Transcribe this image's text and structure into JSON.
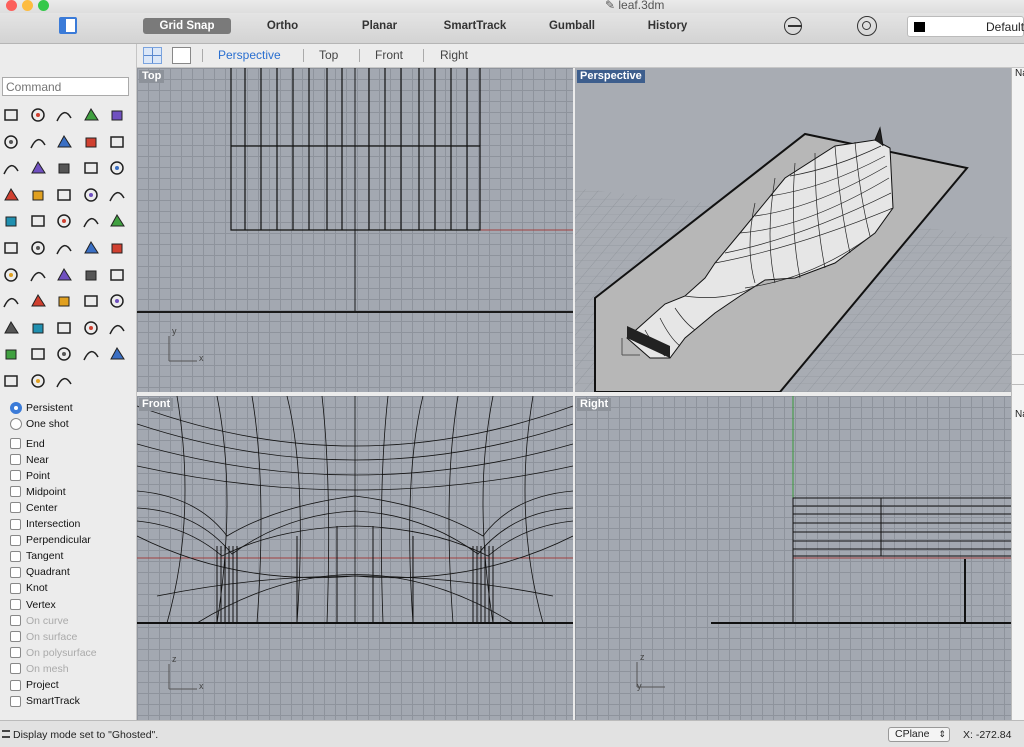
{
  "window": {
    "title": "leaf.3dm"
  },
  "toolbar": {
    "buttons": [
      "Grid Snap",
      "Ortho",
      "Planar",
      "SmartTrack",
      "Gumball",
      "History"
    ],
    "layer_name": "Default"
  },
  "viewport_tabs": [
    "Perspective",
    "Top",
    "Front",
    "Right"
  ],
  "command": {
    "placeholder": "Command"
  },
  "viewports": {
    "top": "Top",
    "perspective": "Perspective",
    "front": "Front",
    "right": "Right"
  },
  "axes": {
    "x": "x",
    "y": "y",
    "z": "z"
  },
  "osnap": {
    "modes": [
      "Persistent",
      "One shot"
    ],
    "items": [
      {
        "label": "End",
        "enabled": true
      },
      {
        "label": "Near",
        "enabled": true
      },
      {
        "label": "Point",
        "enabled": true
      },
      {
        "label": "Midpoint",
        "enabled": true
      },
      {
        "label": "Center",
        "enabled": true
      },
      {
        "label": "Intersection",
        "enabled": true
      },
      {
        "label": "Perpendicular",
        "enabled": true
      },
      {
        "label": "Tangent",
        "enabled": true
      },
      {
        "label": "Quadrant",
        "enabled": true
      },
      {
        "label": "Knot",
        "enabled": true
      },
      {
        "label": "Vertex",
        "enabled": true
      },
      {
        "label": "On curve",
        "enabled": false
      },
      {
        "label": "On surface",
        "enabled": false
      },
      {
        "label": "On polysurface",
        "enabled": false
      },
      {
        "label": "On mesh",
        "enabled": false
      },
      {
        "label": "Project",
        "enabled": true
      },
      {
        "label": "SmartTrack",
        "enabled": true
      }
    ]
  },
  "right_panel": {
    "label1": "Na",
    "label2": "Na"
  },
  "status": {
    "message": "Display mode set to \"Ghosted\".",
    "cplane": "CPlane",
    "coord_x": "X: -272.84"
  },
  "icons": [
    "menu-icon",
    "sidebar-toggle-icon",
    "gumball-circle-icon",
    "target-icon",
    "layer-color-icon",
    "grid-view-icon",
    "single-view-icon"
  ]
}
